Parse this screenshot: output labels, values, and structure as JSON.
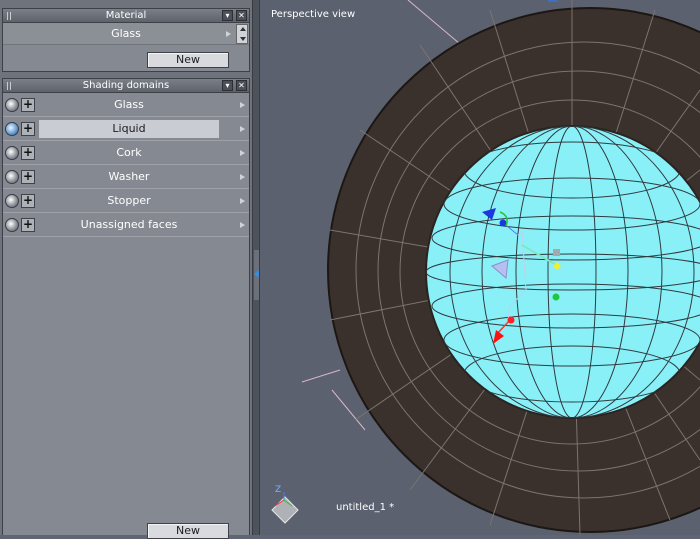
{
  "material_panel": {
    "title": "Material",
    "selected_material": "Glass",
    "new_label": "New"
  },
  "shading_panel": {
    "title": "Shading domains",
    "items": [
      {
        "label": "Glass",
        "selected": false
      },
      {
        "label": "Liquid",
        "selected": true
      },
      {
        "label": "Cork",
        "selected": false
      },
      {
        "label": "Washer",
        "selected": false
      },
      {
        "label": "Stopper",
        "selected": false
      },
      {
        "label": "Unassigned faces",
        "selected": false
      }
    ],
    "new_label": "New"
  },
  "viewport": {
    "title": "Perspective view",
    "document_name": "untitled_1 *",
    "axis_label": "Z"
  },
  "colors": {
    "liquid_fill": "#8af0f8",
    "rim_fill": "#3a302c",
    "viewport_bg": "#5b616e"
  },
  "icons": [
    "grip-icon",
    "collapse-icon",
    "close-icon",
    "visibility-icon",
    "add-icon",
    "expand-arrow-icon",
    "axis-gizmo-icon"
  ]
}
